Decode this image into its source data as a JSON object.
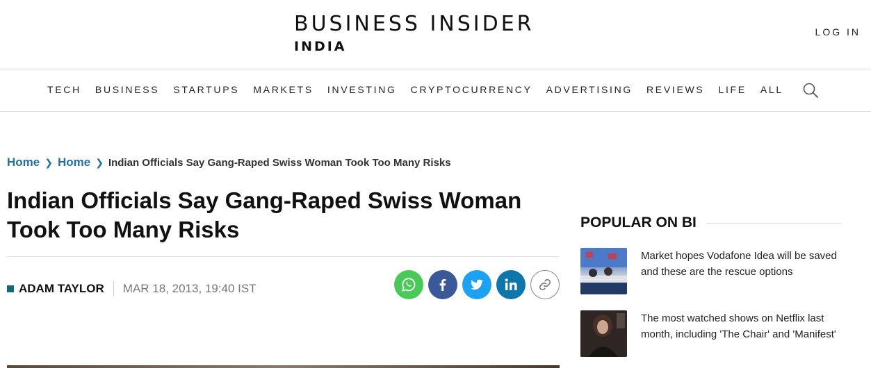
{
  "header": {
    "brand": "BUSINESS INSIDER",
    "edition": "INDIA",
    "login_label": "LOG IN"
  },
  "nav": {
    "items": [
      "TECH",
      "BUSINESS",
      "STARTUPS",
      "MARKETS",
      "INVESTING",
      "CRYPTOCURRENCY",
      "ADVERTISING",
      "REVIEWS",
      "LIFE",
      "ALL"
    ],
    "search_icon": "search-icon"
  },
  "breadcrumb": {
    "items": [
      "Home",
      "Home"
    ],
    "current": "Indian Officials Say Gang-Raped Swiss Woman Took Too Many Risks"
  },
  "article": {
    "headline": "Indian Officials Say Gang-Raped Swiss Woman Took Too Many Risks",
    "author": "ADAM TAYLOR",
    "date": "MAR 18, 2013, 19:40 IST"
  },
  "share": {
    "buttons": [
      "whatsapp-icon",
      "facebook-icon",
      "twitter-icon",
      "linkedin-icon",
      "link-icon"
    ]
  },
  "sidebar": {
    "title": "POPULAR ON BI",
    "stories": [
      {
        "title": "Market hopes Vodafone Idea will be saved and these are the rescue options"
      },
      {
        "title": "The most watched shows on Netflix last month, including 'The Chair' and 'Manifest'"
      }
    ]
  },
  "colors": {
    "link_blue": "#1f6fa8",
    "author_mark": "#15677a",
    "whatsapp": "#4ac959",
    "facebook": "#3b5998",
    "twitter": "#1da1f2",
    "linkedin": "#0e76a8"
  }
}
